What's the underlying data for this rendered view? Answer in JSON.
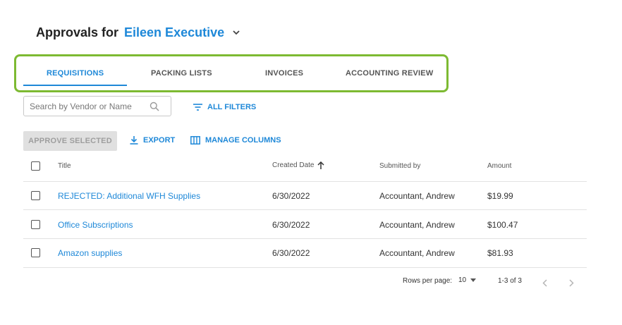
{
  "header": {
    "prefix": "Approvals for",
    "user": "Eileen Executive",
    "dropdown_icon": "chevron-down-icon"
  },
  "tabs": [
    {
      "label": "REQUISITIONS",
      "active": true
    },
    {
      "label": "PACKING LISTS",
      "active": false
    },
    {
      "label": "INVOICES",
      "active": false
    },
    {
      "label": "ACCOUNTING REVIEW",
      "active": false
    }
  ],
  "colors": {
    "accent": "#1e88d8",
    "highlight_border": "#7dba32",
    "disabled_bg": "#e0e0e0"
  },
  "search": {
    "placeholder": "Search by Vendor or Name",
    "value": "",
    "icon": "search-icon"
  },
  "filters": {
    "label": "ALL FILTERS",
    "icon": "filter-icon"
  },
  "toolbar": {
    "approve_label": "APPROVE SELECTED",
    "export_label": "EXPORT",
    "export_icon": "download-icon",
    "manage_label": "MANAGE COLUMNS",
    "manage_icon": "columns-icon"
  },
  "table": {
    "columns": {
      "title": "Title",
      "created": "Created Date",
      "submitted": "Submitted by",
      "amount": "Amount"
    },
    "sort_icon": "arrow-up-icon",
    "rows": [
      {
        "title": "REJECTED: Additional WFH Supplies",
        "created": "6/30/2022",
        "submitted": "Accountant, Andrew",
        "amount": "$19.99"
      },
      {
        "title": "Office Subscriptions",
        "created": "6/30/2022",
        "submitted": "Accountant, Andrew",
        "amount": "$100.47"
      },
      {
        "title": "Amazon supplies",
        "created": "6/30/2022",
        "submitted": "Accountant, Andrew",
        "amount": "$81.93"
      }
    ]
  },
  "pagination": {
    "rows_label": "Rows per page:",
    "rows_value": "10",
    "range": "1-3 of 3"
  }
}
